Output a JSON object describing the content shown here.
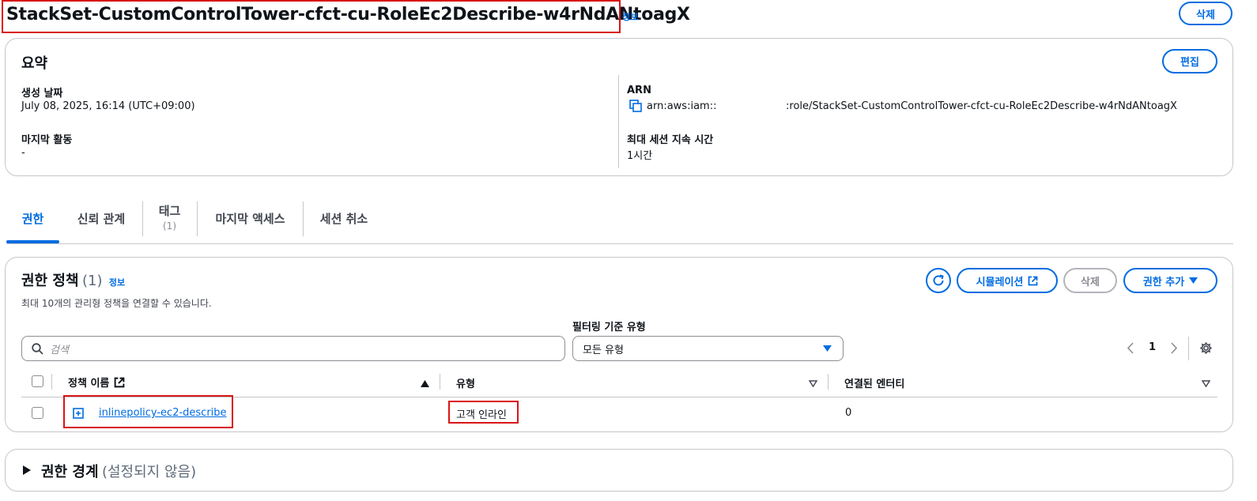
{
  "header": {
    "title": "StackSet-CustomControlTower-cfct-cu-RoleEc2Describe-w4rNdANtoagX",
    "info": "정보",
    "delete_label": "삭제"
  },
  "summary": {
    "title": "요약",
    "edit_label": "편집",
    "created_label": "생성 날짜",
    "created_value": "July 08, 2025, 16:14 (UTC+09:00)",
    "last_activity_label": "마지막 활동",
    "last_activity_value": "-",
    "arn_label": "ARN",
    "arn_prefix": "arn:aws:iam::",
    "arn_suffix": ":role/StackSet-CustomControlTower-cfct-cu-RoleEc2Describe-w4rNdANtoagX",
    "max_session_label": "최대 세션 지속 시간",
    "max_session_value": "1시간"
  },
  "tabs": [
    {
      "label": "권한"
    },
    {
      "label": "신뢰 관계"
    },
    {
      "label": "태그",
      "count": "(1)"
    },
    {
      "label": "마지막 액세스"
    },
    {
      "label": "세션 취소"
    }
  ],
  "policies": {
    "title": "권한 정책",
    "count": "(1)",
    "info": "정보",
    "subtitle": "최대 10개의 관리형 정책을 연결할 수 있습니다.",
    "simulation_label": "시뮬레이션",
    "delete_label": "삭제",
    "add_label": "권한 추가",
    "filter_label": "필터링 기준 유형",
    "search_placeholder": "검색",
    "filter_value": "모든 유형",
    "page_number": "1",
    "columns": {
      "name": "정책 이름",
      "type": "유형",
      "entities": "연결된 엔터티"
    },
    "rows": [
      {
        "name": "inlinepolicy-ec2-describe",
        "type": "고객 인라인",
        "entities": "0"
      }
    ]
  },
  "boundary": {
    "title": "권한 경계",
    "status": "(설정되지 않음)"
  },
  "colors": {
    "accent": "#006ce0",
    "highlight": "#d91515",
    "border": "#c6c6cd"
  }
}
